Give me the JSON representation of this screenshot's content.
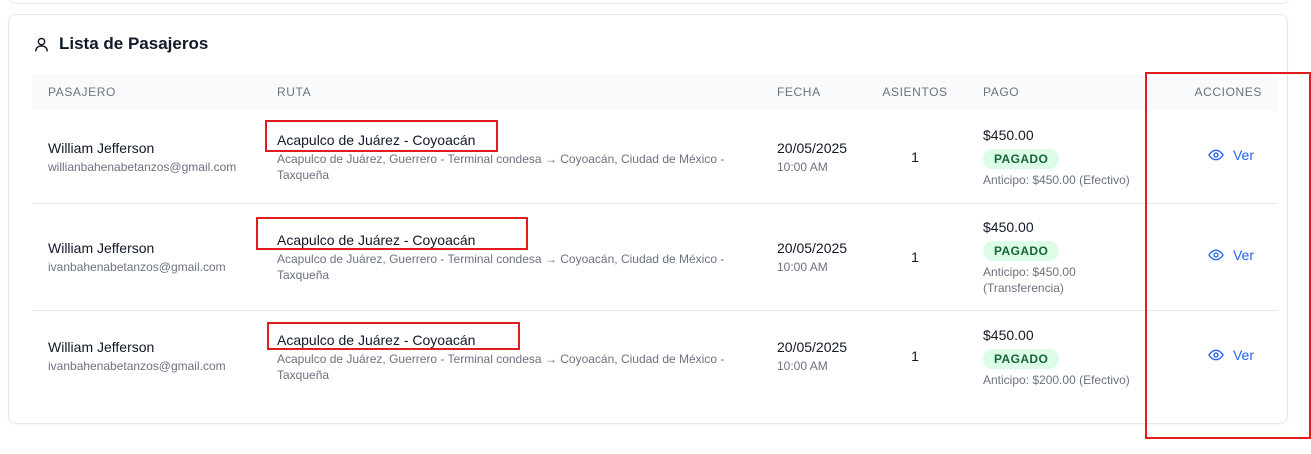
{
  "section": {
    "title": "Lista de Pasajeros",
    "icon": "user-icon"
  },
  "table": {
    "headers": {
      "passenger": "PASAJERO",
      "route": "RUTA",
      "date": "FECHA",
      "seats": "ASIENTOS",
      "payment": "PAGO",
      "actions": "ACCIONES"
    },
    "rows": [
      {
        "name": "William Jefferson",
        "email": "willianbahenabetanzos@gmail.com",
        "route_title": "Acapulco de Juárez - Coyoacán",
        "route_desc": "Acapulco de Juárez, Guerrero - Terminal condesa → Coyoacán, Ciudad de México - Taxqueña",
        "date": "20/05/2025",
        "time": "10:00 AM",
        "seats": "1",
        "amount": "$450.00",
        "status": "PAGADO",
        "advance": "Anticipo: $450.00 (Efectivo)",
        "action": "Ver"
      },
      {
        "name": "William Jefferson",
        "email": "ivanbahenabetanzos@gmail.com",
        "route_title": "Acapulco de Juárez - Coyoacán",
        "route_desc": "Acapulco de Juárez, Guerrero - Terminal condesa → Coyoacán, Ciudad de México - Taxqueña",
        "date": "20/05/2025",
        "time": "10:00 AM",
        "seats": "1",
        "amount": "$450.00",
        "status": "PAGADO",
        "advance": "Anticipo: $450.00 (Transferencia)",
        "action": "Ver"
      },
      {
        "name": "William Jefferson",
        "email": "ivanbahenabetanzos@gmail.com",
        "route_title": "Acapulco de Juárez - Coyoacán",
        "route_desc": "Acapulco de Juárez, Guerrero - Terminal condesa → Coyoacán, Ciudad de México - Taxqueña",
        "date": "20/05/2025",
        "time": "10:00 AM",
        "seats": "1",
        "amount": "$450.00",
        "status": "PAGADO",
        "advance": "Anticipo: $200.00 (Efectivo)",
        "action": "Ver"
      }
    ]
  },
  "colors": {
    "accent": "#2563eb",
    "paid_badge_bg": "#dcfce7",
    "paid_badge_text": "#166534",
    "highlight": "#e11d1d"
  }
}
